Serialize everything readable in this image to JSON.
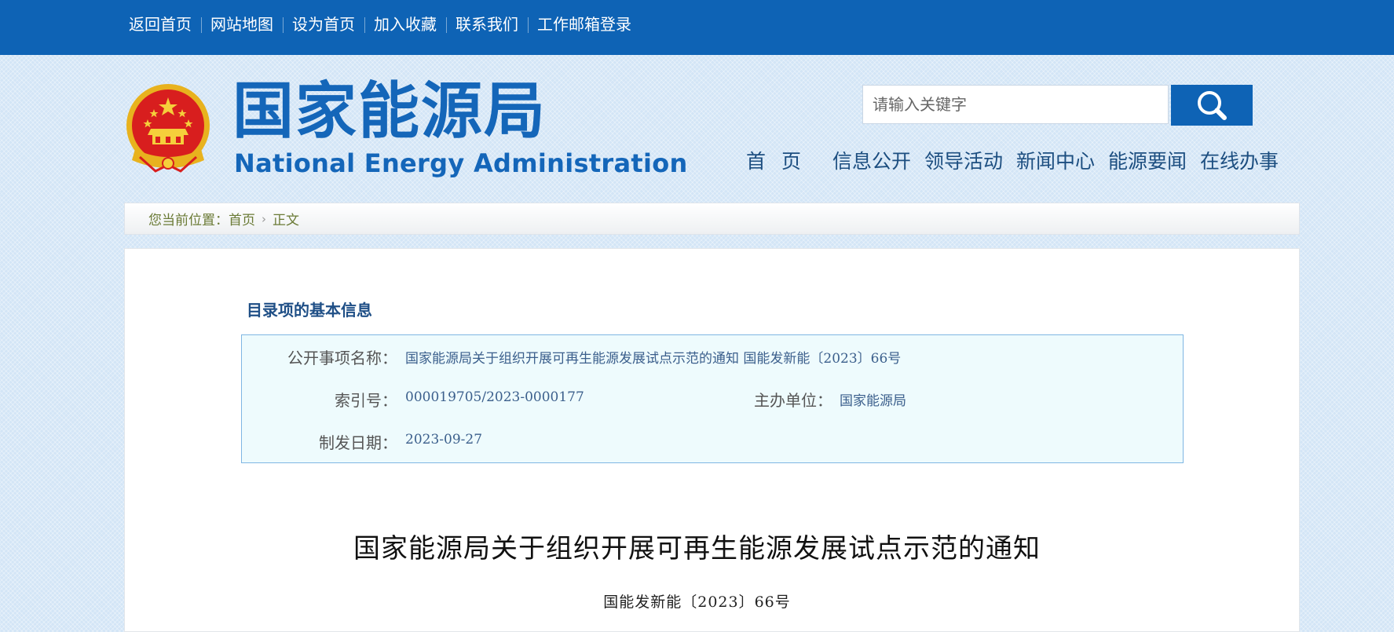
{
  "topbar": {
    "links": [
      "返回首页",
      "网站地图",
      "设为首页",
      "加入收藏",
      "联系我们",
      "工作邮箱登录"
    ]
  },
  "header": {
    "logo_cn": "国家能源局",
    "logo_en": "National Energy Administration",
    "search_placeholder": "请输入关键字",
    "nav": [
      "首 页",
      "信息公开",
      "领导活动",
      "新闻中心",
      "能源要闻",
      "在线办事"
    ]
  },
  "breadcrumb": {
    "prefix": "您当前位置：",
    "home": "首页",
    "current": "正文"
  },
  "info": {
    "section_title": "目录项的基本信息",
    "name_label": "公开事项名称：",
    "name_value": "国家能源局关于组织开展可再生能源发展试点示范的通知 国能发新能〔2023〕66号",
    "index_label": "索引号：",
    "index_value": "000019705/2023-0000177",
    "org_label": "主办单位：",
    "org_value": "国家能源局",
    "date_label": "制发日期：",
    "date_value": "2023-09-27"
  },
  "document": {
    "title": "国家能源局关于组织开展可再生能源发展试点示范的通知",
    "number": "国能发新能〔2023〕66号"
  },
  "colors": {
    "brand_blue": "#0e63b5",
    "logo_blue": "#1466b9",
    "emblem_red": "#d81e1e",
    "emblem_gold": "#f2c12e"
  },
  "icons": [
    "national-emblem-icon",
    "search-icon"
  ]
}
